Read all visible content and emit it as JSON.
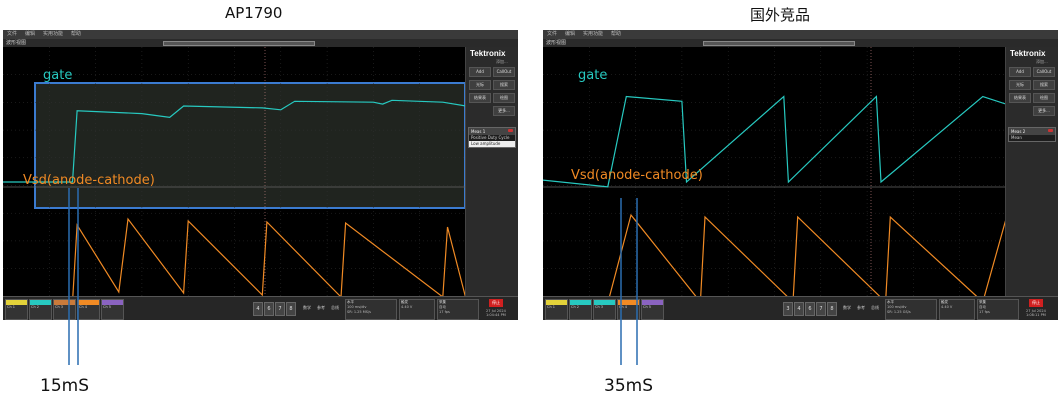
{
  "captions": {
    "left": "AP1790",
    "right": "国外竞品"
  },
  "menu": [
    "文件",
    "编辑",
    "实用功能",
    "帮助"
  ],
  "tab_label": "波形视图",
  "brand": {
    "name": "Tektronix",
    "sub": "添加..."
  },
  "panel_buttons": [
    "Add",
    "CallOut",
    "光标",
    "搜索",
    "结果表",
    "绘图",
    "更多..."
  ],
  "colors": {
    "gate": "#27c9c0",
    "vsd": "#f08a24",
    "ch3": "#c97a3a",
    "ch5": "#8a63c0",
    "accent": "#c02020",
    "cursor": "#2a6db0"
  },
  "scopes": [
    {
      "gate_label": "gate",
      "vsd_label": "Vsd(anode-cathode)",
      "meas_title": "Meas 1",
      "meas_lines": [
        "Positive Duty Cycle",
        "Low amplitude"
      ],
      "channels": [
        "Ch 1",
        "Ch 2",
        "Ch 3",
        "Ch 4",
        "Ch 5"
      ],
      "buttons": [
        "4",
        "6",
        "7",
        "8"
      ],
      "right_labels": [
        "数学",
        "参考",
        "总线"
      ],
      "info1": {
        "head": "水平",
        "lines": [
          "100 ms/div",
          "SR: 1.25 MS/s"
        ]
      },
      "info2": {
        "head": "触发",
        "lines": [
          "4.40 V"
        ]
      },
      "info3": {
        "head": "采集",
        "lines": [
          "自动",
          "17 fps"
        ]
      },
      "run": "停止",
      "date": [
        "27 Jul 2024",
        "1:04:44 PM"
      ],
      "delta": "15mS"
    },
    {
      "gate_label": "gate",
      "vsd_label": "Vsd(anode-cathode)",
      "meas_title": "Meas 2",
      "meas_lines": [
        "Mean"
      ],
      "channels": [
        "Ch 1",
        "Ch 2",
        "Ch 3",
        "Ch 4",
        "Ch 5"
      ],
      "buttons": [
        "3",
        "4",
        "6",
        "7",
        "8"
      ],
      "right_labels": [
        "数学",
        "参考",
        "总线"
      ],
      "info1": {
        "head": "水平",
        "lines": [
          "100 ms/div",
          "SR: 1.25 GS/s"
        ]
      },
      "info2": {
        "head": "触发",
        "lines": [
          "4.40 V"
        ]
      },
      "info3": {
        "head": "采集",
        "lines": [
          "自动",
          "17 fps"
        ]
      },
      "run": "停止",
      "date": [
        "27 Jul 2024",
        "1:08:11 PM"
      ],
      "delta": "35mS"
    }
  ],
  "chart_data": [
    {
      "type": "line",
      "series": [
        {
          "name": "gate",
          "x": [
            0.0,
            0.15,
            0.16,
            0.3,
            0.33,
            0.36,
            0.39,
            0.56,
            0.6,
            0.63,
            0.8,
            0.82,
            0.84,
            0.95,
            1.0
          ],
          "y": [
            0.0,
            0.0,
            0.75,
            0.72,
            0.7,
            0.68,
            0.8,
            0.78,
            0.76,
            0.85,
            0.84,
            0.82,
            0.86,
            0.84,
            0.8
          ]
        },
        {
          "name": "Vsd(anode-cathode)",
          "x": [
            0.0,
            0.15,
            0.16,
            0.25,
            0.27,
            0.39,
            0.4,
            0.56,
            0.57,
            0.73,
            0.74,
            0.95,
            0.96,
            1.0
          ],
          "y": [
            0.05,
            0.05,
            0.82,
            0.15,
            0.88,
            0.14,
            0.86,
            0.12,
            0.85,
            0.1,
            0.84,
            0.1,
            0.8,
            0.08
          ]
        }
      ]
    },
    {
      "type": "line",
      "series": [
        {
          "name": "gate",
          "x": [
            0.0,
            0.14,
            0.18,
            0.3,
            0.31,
            0.52,
            0.53,
            0.72,
            0.73,
            0.95,
            1.0
          ],
          "y": [
            0.02,
            -0.05,
            0.9,
            0.85,
            0.0,
            0.9,
            0.0,
            0.9,
            0.0,
            0.9,
            0.82
          ]
        },
        {
          "name": "Vsd(anode-cathode)",
          "x": [
            0.0,
            0.14,
            0.19,
            0.34,
            0.35,
            0.54,
            0.55,
            0.74,
            0.75,
            0.95,
            1.0
          ],
          "y": [
            0.04,
            0.04,
            0.92,
            0.05,
            0.9,
            0.05,
            0.9,
            0.05,
            0.9,
            0.05,
            0.88
          ]
        }
      ]
    }
  ]
}
